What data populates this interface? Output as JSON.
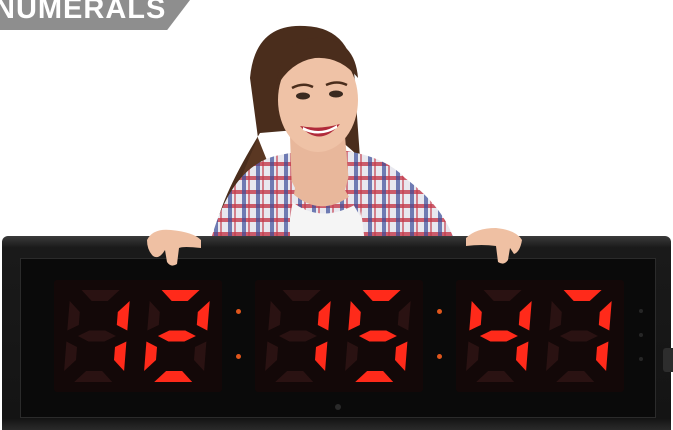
{
  "banner": {
    "text": "NUMERALS"
  },
  "clock": {
    "time_groups": [
      "12",
      "15",
      "47"
    ],
    "digit_color": "#ff2a1a",
    "unlit_color": "#2a1212",
    "colon_color": "#e0561c",
    "frame_color": "#1a1a1a"
  },
  "photo": {
    "subject": "smiling woman holding digital clock"
  }
}
